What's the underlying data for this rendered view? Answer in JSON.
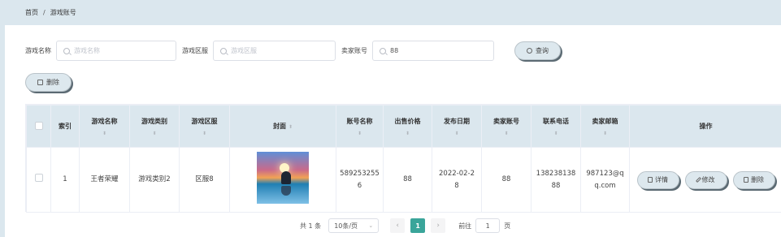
{
  "breadcrumb": {
    "home": "首页",
    "separator": "/",
    "current": "游戏账号"
  },
  "filters": [
    {
      "label": "游戏名称",
      "placeholder": "游戏名称",
      "value": ""
    },
    {
      "label": "游戏区服",
      "placeholder": "游戏区服",
      "value": ""
    },
    {
      "label": "卖家账号",
      "placeholder": "",
      "value": "88"
    }
  ],
  "buttons": {
    "search": "查询",
    "delete": "删除"
  },
  "table": {
    "headers": {
      "index": "索引",
      "game_name": "游戏名称",
      "game_type": "游戏类别",
      "game_zone": "游戏区服",
      "cover": "封面",
      "account_name": "账号名称",
      "price": "出售价格",
      "publish_date": "发布日期",
      "seller_account": "卖家账号",
      "phone": "联系电话",
      "email": "卖家邮箱",
      "actions": "操作"
    },
    "sort_glyph": "⬍",
    "rows": [
      {
        "index": "1",
        "game_name": "王者荣耀",
        "game_type": "游戏类别2",
        "game_zone": "区服8",
        "account_name_l1": "589253255",
        "account_name_l2": "6",
        "price": "88",
        "date_l1": "2022-02-2",
        "date_l2": "8",
        "seller_account": "88",
        "phone_l1": "138238138",
        "phone_l2": "88",
        "email_l1": "987123@q",
        "email_l2": "q.com",
        "actions": {
          "detail": "详情",
          "edit": "修改",
          "delete": "删除"
        }
      }
    ]
  },
  "pagination": {
    "total": "共 1 条",
    "page_size": "10条/页",
    "current_page": "1",
    "goto_label": "前往",
    "goto_value": "1",
    "page_unit": "页"
  },
  "colors": {
    "accent": "#3aa59a",
    "header_bg": "#dbe7ee",
    "button_bg": "#dde8ee"
  }
}
